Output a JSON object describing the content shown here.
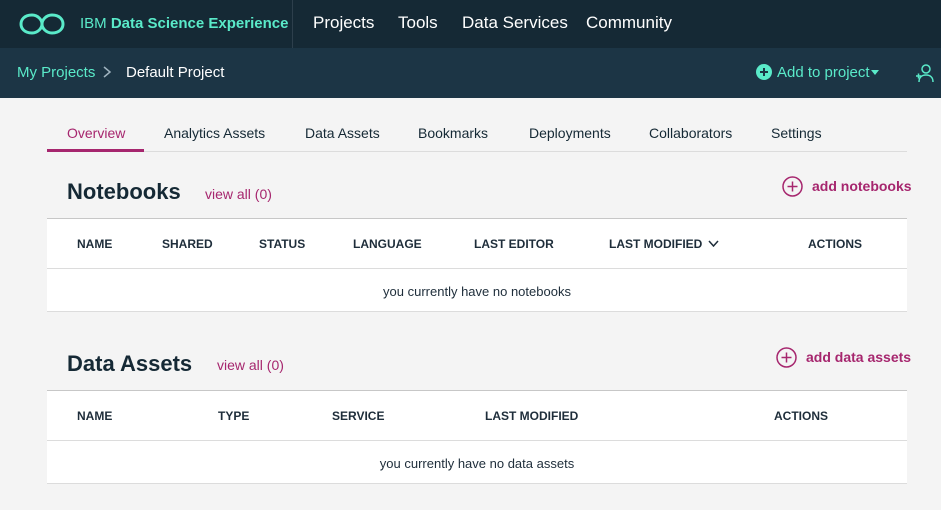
{
  "brand": {
    "ibm": "IBM",
    "name": "Data Science Experience",
    "logo_icon": "infinity-logo-icon",
    "accent": "#5aeac9"
  },
  "topnav": {
    "items": [
      {
        "label": "Projects"
      },
      {
        "label": "Tools"
      },
      {
        "label": "Data Services"
      },
      {
        "label": "Community"
      }
    ]
  },
  "breadcrumb": {
    "parent": "My Projects",
    "separator_icon": "chevron-right-icon",
    "current": "Default Project"
  },
  "add_to_project": {
    "label": "Add to project",
    "icon": "plus-circle-icon",
    "caret_icon": "caret-down-icon"
  },
  "user_icon": "user-add-icon",
  "tabs": [
    {
      "label": "Overview",
      "active": true
    },
    {
      "label": "Analytics Assets"
    },
    {
      "label": "Data Assets"
    },
    {
      "label": "Bookmarks"
    },
    {
      "label": "Deployments"
    },
    {
      "label": "Collaborators"
    },
    {
      "label": "Settings"
    }
  ],
  "notebooks": {
    "title": "Notebooks",
    "view_all": "view all (0)",
    "add_label": "add notebooks",
    "columns": [
      "NAME",
      "SHARED",
      "STATUS",
      "LANGUAGE",
      "LAST EDITOR",
      "LAST MODIFIED",
      "ACTIONS"
    ],
    "sort_icon": "chevron-down-icon",
    "empty_message": "you currently have no notebooks"
  },
  "data_assets": {
    "title": "Data Assets",
    "view_all": "view all (0)",
    "add_label": "add data assets",
    "columns": [
      "NAME",
      "TYPE",
      "SERVICE",
      "LAST MODIFIED",
      "ACTIONS"
    ],
    "empty_message": "you currently have no data assets"
  },
  "colors": {
    "accent_magenta": "#a6266e",
    "topbar": "#152935",
    "subbar": "#1c3545"
  }
}
